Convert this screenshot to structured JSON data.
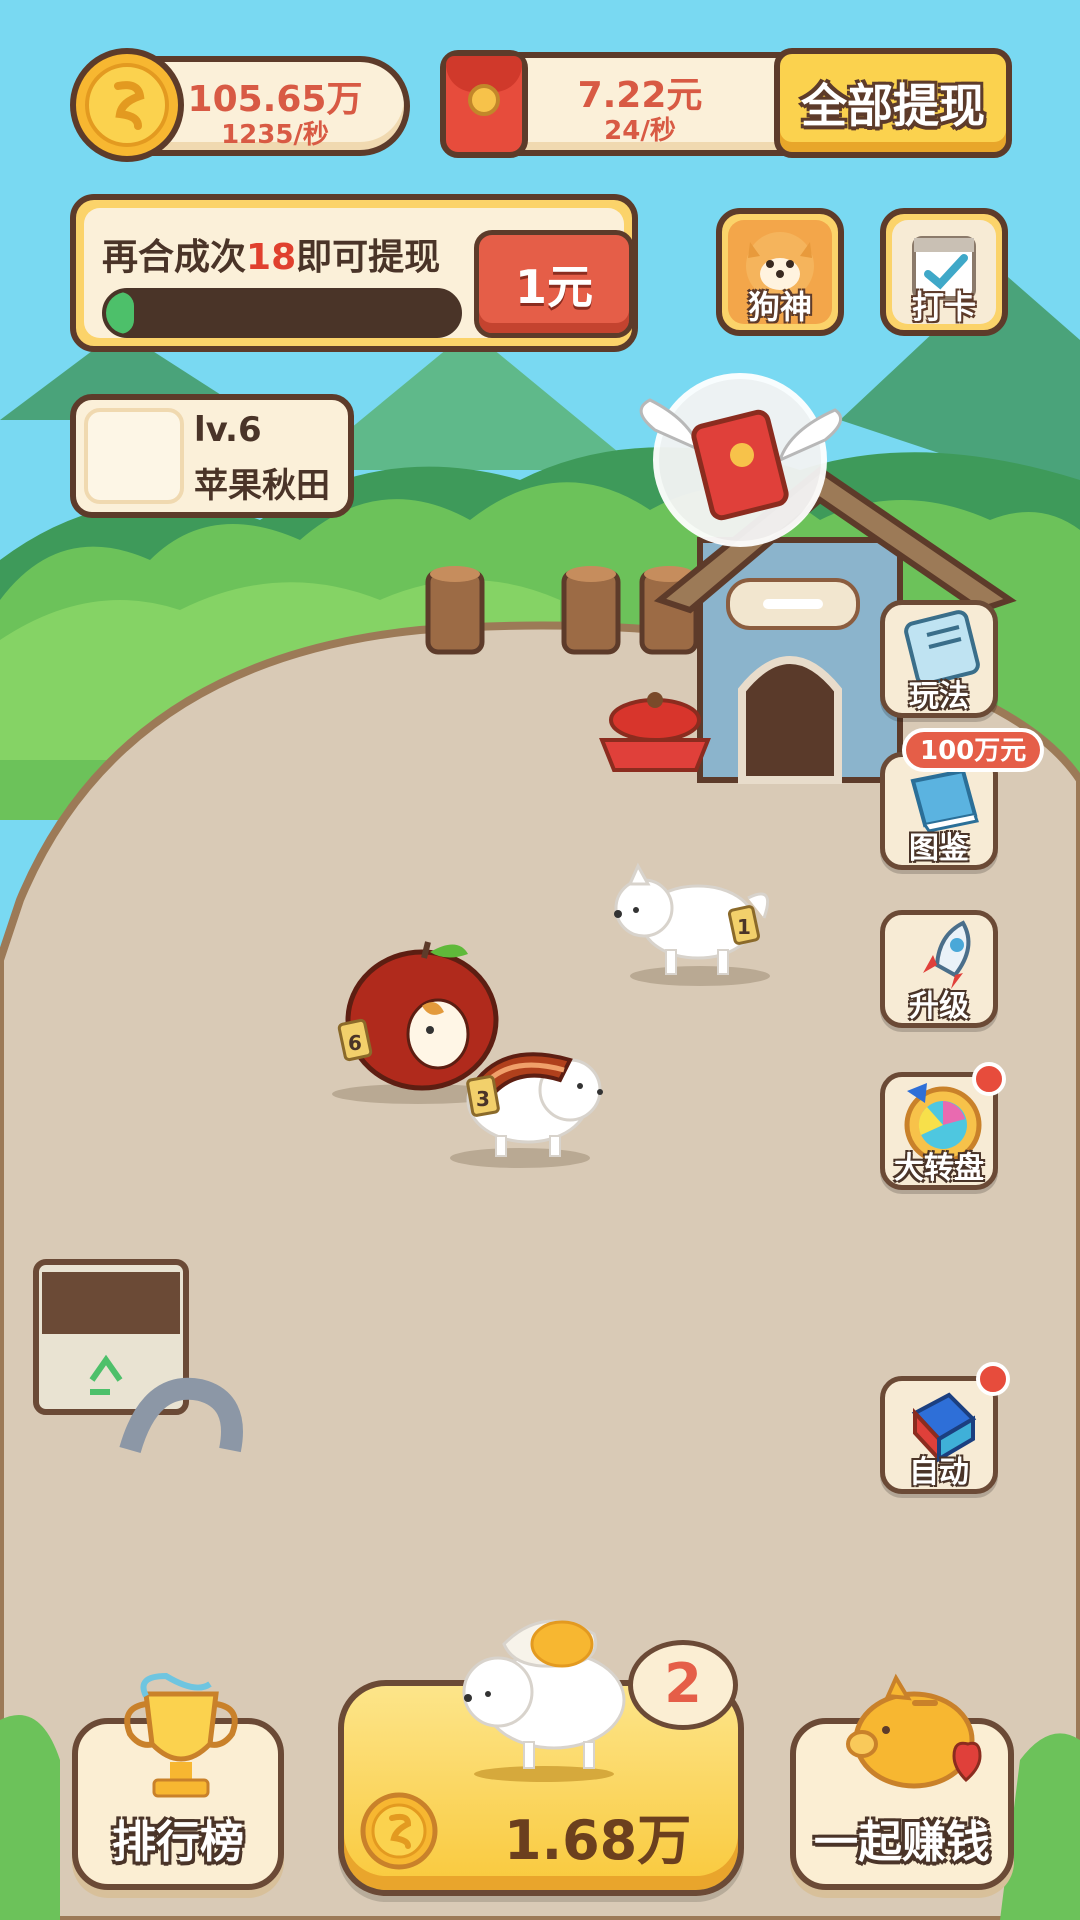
{
  "resources": {
    "coins": {
      "amount": "105.65万",
      "rate": "1235/秒"
    },
    "cash": {
      "amount": "7.22元",
      "rate": "24/秒"
    },
    "withdraw_all_label": "全部提现"
  },
  "task": {
    "text_before": "再合成次",
    "count": "18",
    "text_after": "即可提现",
    "reward_label": "1元",
    "progress_percent": 8
  },
  "top_buttons": {
    "dog_god_label": "狗神",
    "checkin_label": "打卡"
  },
  "level": {
    "number": "lv.6",
    "name": "苹果秋田"
  },
  "side_buttons": {
    "rules_label": "玩法",
    "collection_label": "图鉴",
    "collection_badge": "100万元",
    "upgrade_label": "升级",
    "wheel_label": "大转盘",
    "auto_label": "自动"
  },
  "dogs": [
    {
      "level_tag": "1"
    },
    {
      "level_tag": "6"
    },
    {
      "level_tag": "3"
    }
  ],
  "bottom": {
    "leaderboard_label": "排行榜",
    "buy_price": "1.68万",
    "buy_dog_level": "2",
    "earn_together_label": "一起赚钱"
  },
  "colors": {
    "sky": "#79d9f2",
    "ground": "#d9cab6",
    "accent_red": "#e55e48",
    "accent_gold": "#fbd24e",
    "outline_brown": "#5d3b2a"
  }
}
